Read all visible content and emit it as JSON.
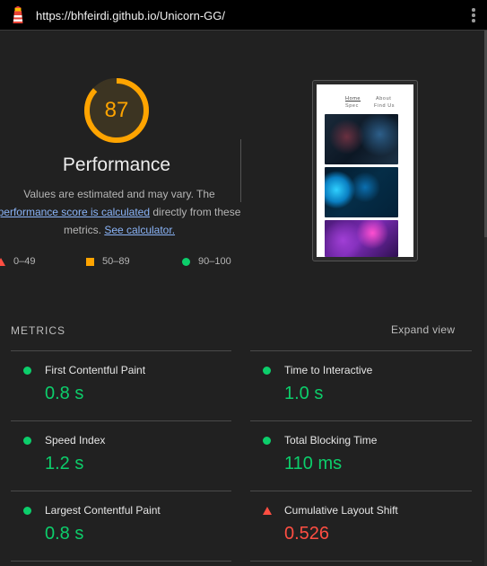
{
  "browser": {
    "url": "https://bhfeirdi.github.io/Unicorn-GG/",
    "logo_icon": "lighthouse-icon",
    "menu_icon": "kebab-menu-icon"
  },
  "performance": {
    "score": "87",
    "score_fraction": 0.87,
    "score_color": "#ffa400",
    "title": "Performance",
    "desc_part1": "Values are estimated and may vary. The",
    "desc_link1": "performance score is calculated",
    "desc_part2": "directly from these metrics.",
    "desc_link2": "See calculator."
  },
  "legend": [
    {
      "range": "0–49",
      "icon": "red-triangle-icon",
      "color": "#ff4e42"
    },
    {
      "range": "50–89",
      "icon": "orange-square-icon",
      "color": "#ffa400"
    },
    {
      "range": "90–100",
      "icon": "green-circle-icon",
      "color": "#0cce6b"
    }
  ],
  "screenshot": {
    "nav": [
      "Home",
      "About",
      "Spec",
      "Find Us"
    ]
  },
  "metrics": {
    "title": "METRICS",
    "expand_label": "Expand view",
    "items": [
      {
        "label": "First Contentful Paint",
        "value": "0.8 s",
        "status": "pass"
      },
      {
        "label": "Time to Interactive",
        "value": "1.0 s",
        "status": "pass"
      },
      {
        "label": "Speed Index",
        "value": "1.2 s",
        "status": "pass"
      },
      {
        "label": "Total Blocking Time",
        "value": "110 ms",
        "status": "pass"
      },
      {
        "label": "Largest Contentful Paint",
        "value": "0.8 s",
        "status": "pass"
      },
      {
        "label": "Cumulative Layout Shift",
        "value": "0.526",
        "status": "fail"
      }
    ]
  },
  "colors": {
    "pass": "#0cce6b",
    "average": "#ffa400",
    "fail": "#ff4e42",
    "link": "#8ab4f8",
    "background": "#212121"
  }
}
